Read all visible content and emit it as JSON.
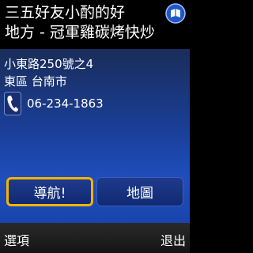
{
  "header": {
    "title_line1": "三五好友小酌的好",
    "title_line2": "地方 - 冠軍雞碳烤快炒",
    "menu_icon": "compass-globe-icon"
  },
  "details": {
    "address_line1": "小東路250號之4",
    "address_line2": "東區 台南市",
    "phone_icon": "phone-handset-icon",
    "phone": "06-234-1863"
  },
  "buttons": {
    "navigate_label": "導航!",
    "map_label": "地圖"
  },
  "softkeys": {
    "left_label": "選項",
    "right_label": "退出"
  },
  "colors": {
    "content_blue": "#1a3e96",
    "highlight_border": "#f2b400",
    "softkey_bar": "#1e1e1e"
  }
}
